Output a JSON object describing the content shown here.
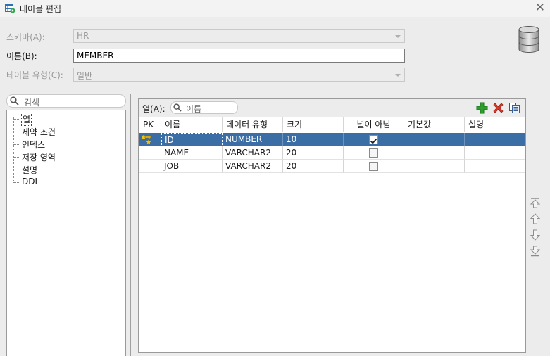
{
  "window": {
    "title": "테이블 편집",
    "close_glyph": "✕"
  },
  "form": {
    "schema": {
      "label": "스키마(A):",
      "value": "HR"
    },
    "name": {
      "label": "이름(B):",
      "value": "MEMBER"
    },
    "table_type": {
      "label": "테이블 유형(C):",
      "value": "일반"
    }
  },
  "left_search": {
    "placeholder": "검색"
  },
  "tree": {
    "items": [
      "열",
      "제약 조건",
      "인덱스",
      "저장 영역",
      "설명",
      "DDL"
    ]
  },
  "columns_panel": {
    "label": "열(A):",
    "search_placeholder": "이름",
    "headers": [
      "PK",
      "이름",
      "데이터 유형",
      "크기",
      "널이 아님",
      "기본값",
      "설명"
    ],
    "rows": [
      {
        "pk": true,
        "name": "ID",
        "type": "NUMBER",
        "size": "10",
        "not_null": true,
        "default": "",
        "comment": ""
      },
      {
        "pk": false,
        "name": "NAME",
        "type": "VARCHAR2",
        "size": "20",
        "not_null": false,
        "default": "",
        "comment": ""
      },
      {
        "pk": false,
        "name": "JOB",
        "type": "VARCHAR2",
        "size": "20",
        "not_null": false,
        "default": "",
        "comment": ""
      }
    ]
  },
  "colors": {
    "selection": "#3a6ea5",
    "add_green": "#2e9e2e",
    "delete_red": "#d83a2a"
  },
  "icons": [
    "table-edit-icon",
    "database-icon",
    "search-icon",
    "add-column-icon",
    "delete-column-icon",
    "copy-column-icon",
    "primary-key-icon",
    "move-top-icon",
    "move-up-icon",
    "move-down-icon",
    "move-bottom-icon"
  ]
}
